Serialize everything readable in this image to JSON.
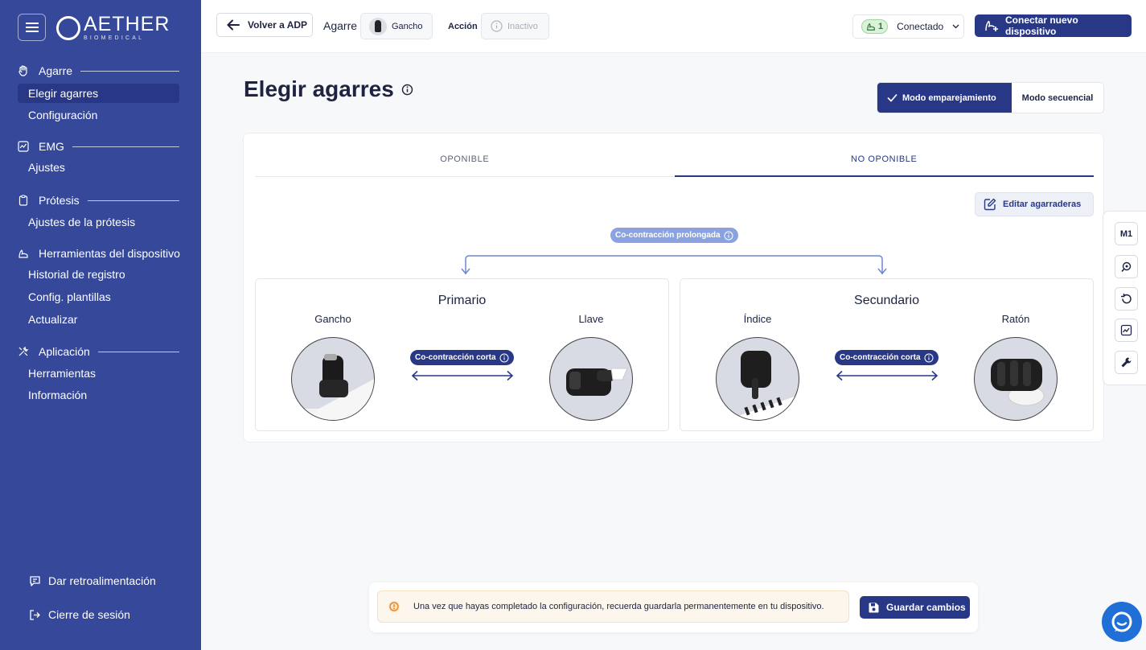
{
  "brand": {
    "name": "AETHER",
    "subtitle": "BIOMEDICAL"
  },
  "sidebar": {
    "sections": [
      {
        "label": "Agarre",
        "items": [
          "Elegir agarres",
          "Configuración"
        ]
      },
      {
        "label": "EMG",
        "items": [
          "Ajustes"
        ]
      },
      {
        "label": "Prótesis",
        "items": [
          "Ajustes de la prótesis"
        ]
      },
      {
        "label": "Herramientas del dispositivo",
        "items": [
          "Historial de registro",
          "Config. plantillas",
          "Actualizar"
        ]
      },
      {
        "label": "Aplicación",
        "items": [
          "Herramientas",
          "Información"
        ]
      }
    ],
    "active_item": "Elegir agarres",
    "footer": {
      "feedback": "Dar retroalimentación",
      "logout": "Cierre de sesión"
    }
  },
  "topbar": {
    "back_label": "Volver a ADP",
    "grip_label": "Agarre",
    "grip_value": "Gancho",
    "action_label": "Acción",
    "action_value": "Inactivo",
    "status_count": "1",
    "status_label": "Conectado",
    "connect_label": "Conectar nuevo dispositivo"
  },
  "main": {
    "title": "Elegir agarres",
    "modes": {
      "active": "Modo emparejamiento",
      "other": "Modo secuencial"
    },
    "tabs": [
      {
        "label": "OPONIBLE",
        "active": false
      },
      {
        "label": "NO OPONIBLE",
        "active": true
      }
    ],
    "edit_label": "Editar agarraderas",
    "long_cocontraction": "Co-contracción prolongada",
    "groups": [
      {
        "title": "Primario",
        "left": "Gancho",
        "right": "Llave",
        "switch": "Co-contracción corta"
      },
      {
        "title": "Secundario",
        "left": "Índice",
        "right": "Ratón",
        "switch": "Co-contracción corta"
      }
    ]
  },
  "rail": {
    "m1_label": "M1"
  },
  "notice": {
    "text": "Una vez que hayas completado la configuración, recuerda guardarla permanentemente en tu dispositivo.",
    "save_label": "Guardar cambios"
  },
  "colors": {
    "sidebar": "#35489a",
    "primary": "#283886",
    "accent_light": "#8aa2e0",
    "chat": "#1f6fd6"
  }
}
